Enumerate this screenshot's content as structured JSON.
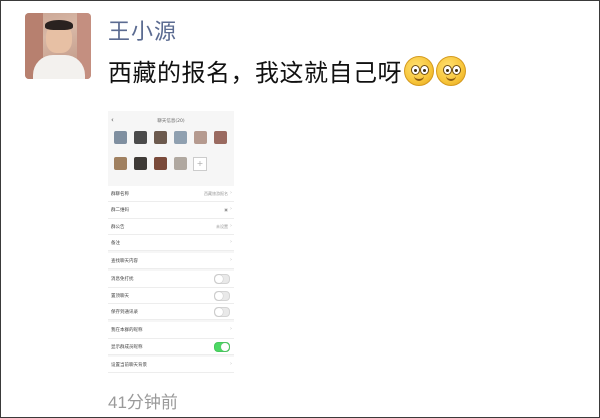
{
  "post": {
    "author_name": "王小源",
    "message_text": "西藏的报名，我这就自己呀",
    "emojis": [
      "woozy-face-emoji",
      "pleading-face-emoji"
    ],
    "timestamp": "41分钟前"
  },
  "phone_screenshot": {
    "title": "聊天信息(20)",
    "back_symbol": "‹",
    "members": [
      {
        "caption": ""
      },
      {
        "caption": ""
      },
      {
        "caption": ""
      },
      {
        "caption": ""
      },
      {
        "caption": ""
      },
      {
        "caption": ""
      },
      {
        "caption": ""
      },
      {
        "caption": ""
      },
      {
        "caption": ""
      },
      {
        "caption": ""
      }
    ],
    "add_symbol": "+",
    "settings": [
      {
        "label": "群聊名称",
        "value": "西藏旅游报名",
        "control": "chevron"
      },
      {
        "label": "群二维码",
        "value": "▣",
        "control": "chevron"
      },
      {
        "label": "群公告",
        "value": "未设置",
        "control": "chevron"
      },
      {
        "label": "备注",
        "value": "",
        "control": "chevron"
      },
      {
        "label": "查找聊天内容",
        "value": "",
        "control": "chevron",
        "gap": true
      },
      {
        "label": "消息免打扰",
        "value": "",
        "control": "toggle",
        "on": false,
        "gap": true
      },
      {
        "label": "置顶聊天",
        "value": "",
        "control": "toggle",
        "on": false
      },
      {
        "label": "保存到通讯录",
        "value": "",
        "control": "toggle",
        "on": false
      },
      {
        "label": "我在本群的昵称",
        "value": "",
        "control": "chevron",
        "gap": true
      },
      {
        "label": "显示群成员昵称",
        "value": "",
        "control": "toggle",
        "on": true
      },
      {
        "label": "设置当前聊天背景",
        "value": "",
        "control": "chevron",
        "gap": true
      }
    ]
  }
}
